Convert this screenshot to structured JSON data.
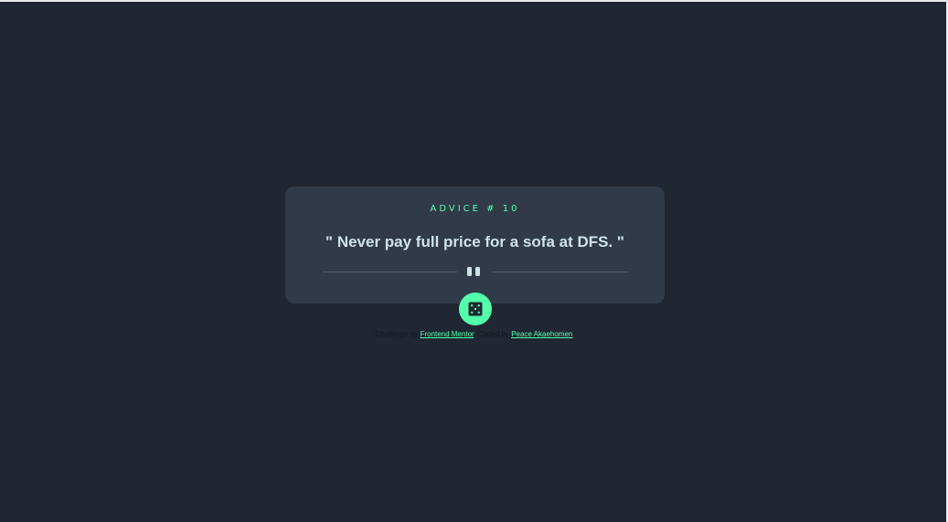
{
  "advice": {
    "label": "ADVICE # 10",
    "quote": "\" Never pay full price for a sofa at DFS. \""
  },
  "controls": {
    "dice_icon": "dice-icon",
    "divider_icon": "pause-icon"
  },
  "attribution": {
    "prefix": "Challenge by",
    "challenge_link": "Frontend Mentor",
    "middle": ". Coded by",
    "author_link": "Peace Akaehomen"
  },
  "colors": {
    "background": "#202632",
    "card": "#313a49",
    "accent": "#53ffaa",
    "quote_text": "#cee3e9",
    "divider": "#4f5b6f"
  }
}
